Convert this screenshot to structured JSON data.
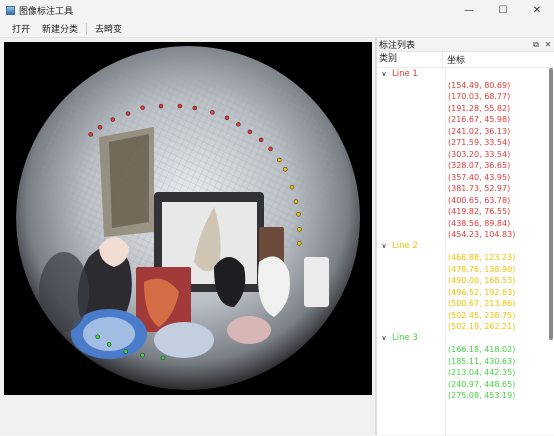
{
  "window": {
    "title": "图像标注工具",
    "controls": {
      "minimize": "—",
      "maximize": "☐",
      "close": "✕"
    }
  },
  "menu": {
    "open": "打开",
    "new_category": "新建分类",
    "undistort": "去畸变"
  },
  "dock": {
    "title": "标注列表",
    "float_icon": "⧉",
    "close_icon": "✕",
    "columns": {
      "category": "类别",
      "coords": "坐标"
    }
  },
  "colors": {
    "line1": "#e53935",
    "line2": "#f2c200",
    "line3": "#43d443"
  },
  "groups": [
    {
      "name": "Line 1",
      "color": "#e53935",
      "coords": [
        "(154.49, 80.69)",
        "(170.03, 68.77)",
        "(191.28, 55.82)",
        "(216.67, 45.98)",
        "(241.02, 36.13)",
        "(271.59, 33.54)",
        "(303.20, 33.54)",
        "(328.07, 36.65)",
        "(357.40, 43.95)",
        "(381.73, 52.97)",
        "(400.65, 63.78)",
        "(419.82, 76.55)",
        "(438.56, 89.84)",
        "(454.23, 104.83)"
      ]
    },
    {
      "name": "Line 2",
      "color": "#f2c200",
      "coords": [
        "(468.88, 123.23)",
        "(478.76, 138.90)",
        "(490.00, 168.53)",
        "(496.52, 192.63)",
        "(500.67, 213.86)",
        "(502.45, 238.75)",
        "(502.18, 262.21)"
      ]
    },
    {
      "name": "Line 3",
      "color": "#43d443",
      "coords": [
        "(166.18, 418.02)",
        "(185.11, 430.63)",
        "(213.04, 442.35)",
        "(240.97, 448.65)",
        "(275.08, 453.19)"
      ]
    }
  ]
}
